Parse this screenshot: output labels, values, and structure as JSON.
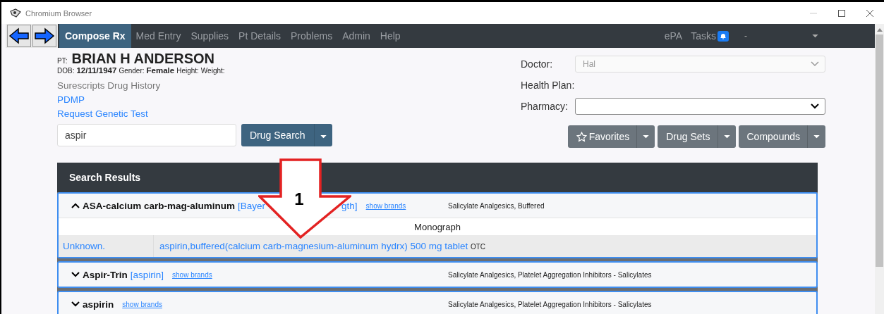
{
  "window": {
    "title": "Chromium Browser"
  },
  "nav": {
    "items": [
      {
        "label": "Compose Rx",
        "selected": true
      },
      {
        "label": "Med Entry",
        "selected": false
      },
      {
        "label": "Supplies",
        "selected": false
      },
      {
        "label": "Pt Details",
        "selected": false
      },
      {
        "label": "Problems",
        "selected": false
      },
      {
        "label": "Admin",
        "selected": false
      },
      {
        "label": "Help",
        "selected": false
      }
    ],
    "right": {
      "epa": "ePA",
      "tasks": "Tasks",
      "user": "-"
    }
  },
  "patient": {
    "pt_label": "PT:",
    "name": "BRIAN H ANDERSON",
    "dob_label": "DOB:",
    "dob": "12/11/1947",
    "gender_label": "Gender:",
    "gender": "Female",
    "height_label": "Height:",
    "weight_label": "Weight:",
    "links": [
      {
        "label": "Surescripts Drug History",
        "disabled": true
      },
      {
        "label": "PDMP",
        "disabled": false
      },
      {
        "label": "Request Genetic Test",
        "disabled": false
      }
    ]
  },
  "search": {
    "value": "aspir",
    "button": "Drug Search"
  },
  "right_panel": {
    "doctor_label": "Doctor:",
    "doctor": "Hal",
    "health_plan_label": "Health Plan:",
    "pharmacy_label": "Pharmacy:",
    "buttons": [
      {
        "label": "Favorites",
        "kind": "star"
      },
      {
        "label": "Drug Sets",
        "kind": "plain"
      },
      {
        "label": "Compounds",
        "kind": "plain"
      }
    ]
  },
  "results": {
    "title": "Search Results",
    "rows": [
      {
        "name": "ASA-calcium carb-mag-aluminum",
        "brand_parts": [
          "[Bayer",
          "gth]"
        ],
        "show_brands": "show brands",
        "class": "Salicylate Analgesics, Buffered",
        "expanded": true,
        "monograph": "Monograph",
        "products": [
          {
            "status": "Unknown.",
            "description": "aspirin,buffered(calcium carb-magnesium-aluminum hydrx) 500 mg tablet",
            "tag": "OTC"
          }
        ]
      },
      {
        "name": "Aspir-Trin",
        "brand_parts": [
          "[aspirin]"
        ],
        "show_brands": "show brands",
        "class": "Salicylate Analgesics, Platelet Aggregation Inhibitors - Salicylates",
        "expanded": false
      },
      {
        "name": "aspirin",
        "show_brands": "show brands",
        "class": "Salicylate Analgesics, Platelet Aggregation Inhibitors - Salicylates",
        "expanded": false
      }
    ]
  },
  "annotation": {
    "label": "1"
  }
}
